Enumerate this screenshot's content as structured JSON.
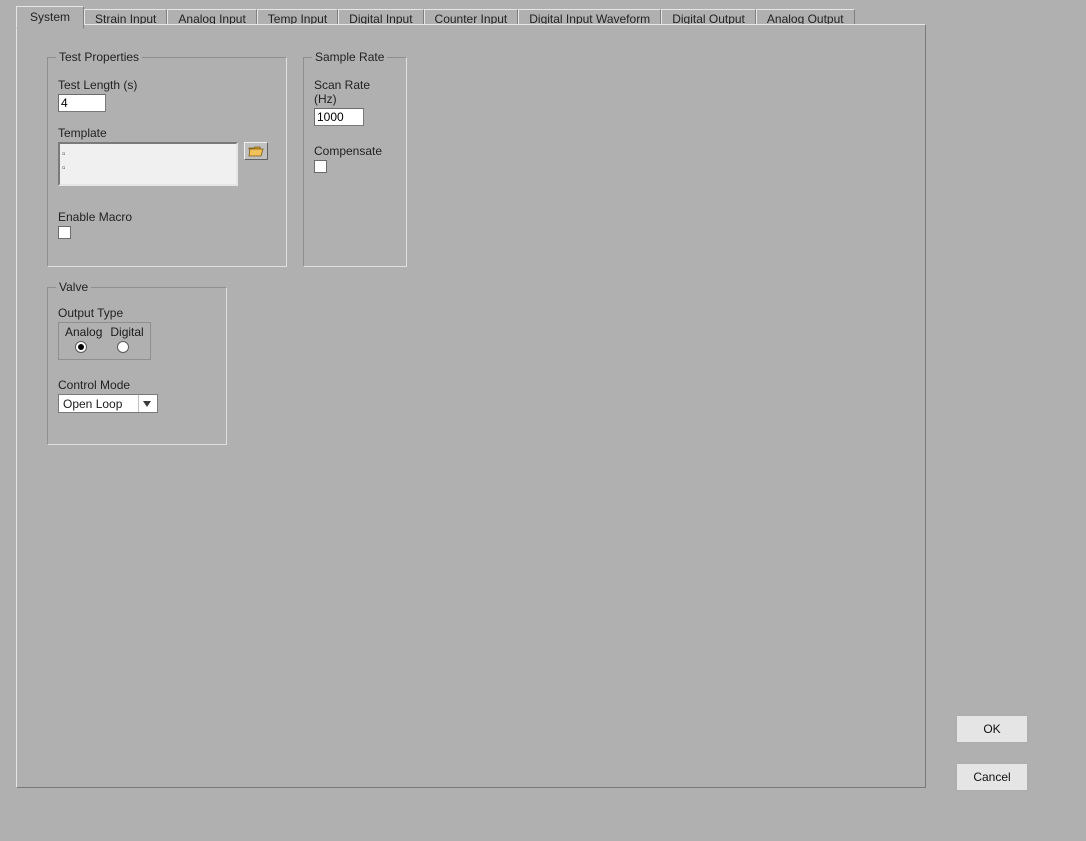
{
  "tabs": [
    "System",
    "Strain Input",
    "Analog Input",
    "Temp Input",
    "Digital Input",
    "Counter Input",
    "Digital Input Waveform",
    "Digital Output",
    "Analog Output"
  ],
  "active_tab_index": 0,
  "test_properties": {
    "legend": "Test Properties",
    "test_length_label": "Test Length (s)",
    "test_length_value": "4",
    "template_label": "Template",
    "template_value": "",
    "enable_macro_label": "Enable Macro",
    "enable_macro_checked": false
  },
  "sample_rate": {
    "legend": "Sample Rate",
    "scan_rate_label": "Scan Rate (Hz)",
    "scan_rate_value": "1000",
    "compensate_label": "Compensate",
    "compensate_checked": false
  },
  "valve": {
    "legend": "Valve",
    "output_type_label": "Output Type",
    "radio_analog": "Analog",
    "radio_digital": "Digital",
    "selected_output_type": "Analog",
    "control_mode_label": "Control Mode",
    "control_mode_value": "Open Loop"
  },
  "buttons": {
    "ok": "OK",
    "cancel": "Cancel"
  },
  "icons": {
    "folder": "folder-open-icon"
  }
}
